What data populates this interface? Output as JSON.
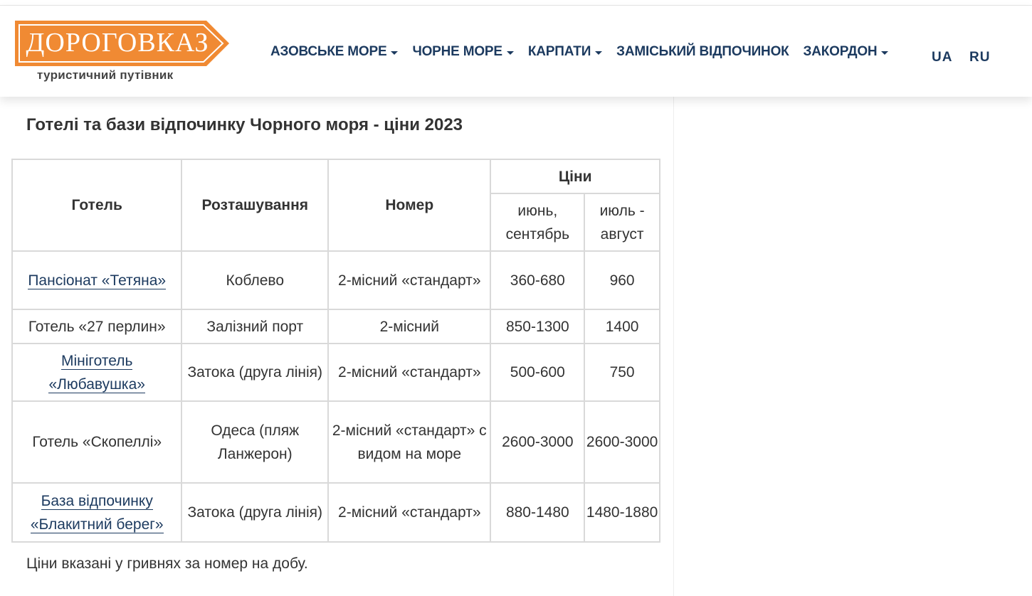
{
  "brand": {
    "name": "ДОРОГОВКАЗ",
    "tagline": "туристичний путівник",
    "color": "#f08a33"
  },
  "nav": {
    "items": [
      {
        "label": "АЗОВСЬКЕ МОРЕ",
        "dropdown": true
      },
      {
        "label": "ЧОРНЕ МОРЕ",
        "dropdown": true
      },
      {
        "label": "КАРПАТИ",
        "dropdown": true
      },
      {
        "label": "ЗАМІСЬКИЙ ВІДПОЧИНОК",
        "dropdown": false
      },
      {
        "label": "ЗАКОРДОН",
        "dropdown": true
      }
    ],
    "languages": [
      "UA",
      "RU"
    ]
  },
  "page": {
    "title": "Готелі та бази відпочинку Чорного моря - ціни 2023",
    "footnote": "Ціни вказані у гривнях за номер на добу."
  },
  "table": {
    "headers": {
      "hotel": "Готель",
      "location": "Розташування",
      "room": "Номер",
      "prices": "Ціни",
      "period1": "июнь, сентябрь",
      "period2": "июль - август"
    },
    "rows": [
      {
        "hotel": "Пансіонат «Тетяна»",
        "link": true,
        "location": "Коблево",
        "room": "2-місний «стандарт»",
        "price1": "360-680",
        "price2": "960"
      },
      {
        "hotel": "Готель «27 перлин»",
        "link": false,
        "location": "Залізний порт",
        "room": "2-місний",
        "price1": "850-1300",
        "price2": "1400"
      },
      {
        "hotel": "Мініготель «Любавушка»",
        "link": true,
        "location": "Затока (друга лінія)",
        "room": "2-місний «стандарт»",
        "price1": "500-600",
        "price2": "750"
      },
      {
        "hotel": "Готель «Скопеллі»",
        "link": false,
        "location": "Одеса (пляж Ланжерон)",
        "room": "2-місний «стандарт» с видом на море",
        "price1": "2600-3000",
        "price2": "2600-3000"
      },
      {
        "hotel": "База відпочинку «Блакитний берег»",
        "link": true,
        "location": "Затока (друга лінія)",
        "room": "2-місний «стандарт»",
        "price1": "880-1480",
        "price2": "1480-1880"
      }
    ]
  },
  "colors": {
    "nav_text": "#1c3a5f",
    "link": "#1c3a5f",
    "border": "#d9d9d9",
    "logo_orange": "#f08a33"
  }
}
